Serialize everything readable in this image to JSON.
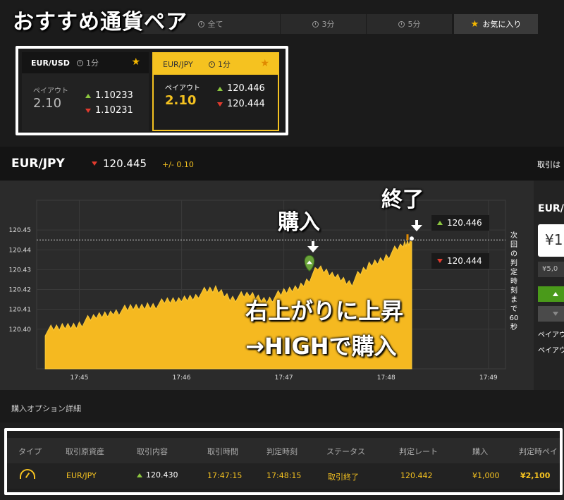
{
  "overlay": {
    "title": "おすすめ通貨ペア",
    "buy_label": "購入",
    "end_label": "終了",
    "rise_label": "右上がりに上昇",
    "high_label": "→HIGHで購入"
  },
  "tabs": [
    {
      "label": "全て",
      "icon": "clock-icon"
    },
    {
      "label": "3分",
      "icon": "clock-icon"
    },
    {
      "label": "5分",
      "icon": "clock-icon"
    },
    {
      "label": "お気に入り",
      "icon": "star-icon",
      "active": true
    }
  ],
  "pairs": [
    {
      "symbol": "EUR/USD",
      "timeframe": "1分",
      "payout_label": "ペイアウト",
      "payout": "2.10",
      "high_rate": "1.10233",
      "low_rate": "1.10231",
      "selected": false
    },
    {
      "symbol": "EUR/JPY",
      "timeframe": "1分",
      "payout_label": "ペイアウト",
      "payout": "2.10",
      "high_rate": "120.446",
      "low_rate": "120.444",
      "selected": true
    }
  ],
  "asset": {
    "name": "EUR/JPY",
    "rate": "120.445",
    "change": "+/- 0.10",
    "right_text": "取引は"
  },
  "chart": {
    "current_line": "120.445",
    "high_tag": "120.446",
    "low_tag": "120.444",
    "countdown_text": "次回の判定時刻まで60秒"
  },
  "chart_data": {
    "type": "area",
    "x_ticks": [
      "17:45",
      "17:46",
      "17:47",
      "17:48",
      "17:49"
    ],
    "y_ticks": [
      "120.40",
      "120.41",
      "120.42",
      "120.43",
      "120.44",
      "120.45"
    ],
    "ylim": [
      120.38,
      120.465
    ],
    "x": [
      "17:44:40",
      "17:44:50",
      "17:45:00",
      "17:45:10",
      "17:45:20",
      "17:45:30",
      "17:45:40",
      "17:45:50",
      "17:46:00",
      "17:46:10",
      "17:46:20",
      "17:46:30",
      "17:46:40",
      "17:46:50",
      "17:47:00",
      "17:47:10",
      "17:47:20",
      "17:47:30",
      "17:47:40",
      "17:47:50",
      "17:48:00",
      "17:48:10",
      "17:48:15"
    ],
    "values": [
      120.399,
      120.401,
      120.403,
      120.406,
      120.409,
      120.41,
      120.412,
      120.413,
      120.415,
      120.418,
      120.42,
      120.416,
      120.417,
      120.415,
      120.418,
      120.422,
      120.43,
      120.427,
      120.424,
      120.432,
      120.437,
      120.442,
      120.445
    ],
    "buy_point": {
      "x": "17:47:15",
      "y": 120.43
    },
    "end_point": {
      "x": "17:48:15",
      "y": 120.445
    }
  },
  "right_panel": {
    "title": "EUR/",
    "amount_input": "¥1",
    "amount_preset": "¥5,0",
    "payout_label_1": "ペイアウ",
    "payout_label_2": "ペイアウ"
  },
  "details": {
    "title": "購入オプション詳細",
    "headers": [
      "タイプ",
      "取引原資産",
      "取引内容",
      "取引時間",
      "判定時刻",
      "ステータス",
      "判定レート",
      "購入",
      "判定時ペイ"
    ],
    "row": {
      "asset": "EUR/JPY",
      "content": "120.430",
      "trade_time": "17:47:15",
      "judge_time": "17:48:15",
      "status": "取引終了",
      "judge_rate": "120.442",
      "purchase": "¥1,000",
      "payout": "¥2,100"
    }
  },
  "colors": {
    "accent": "#f5c220",
    "up": "#8cc63f",
    "down": "#e23b2e"
  }
}
